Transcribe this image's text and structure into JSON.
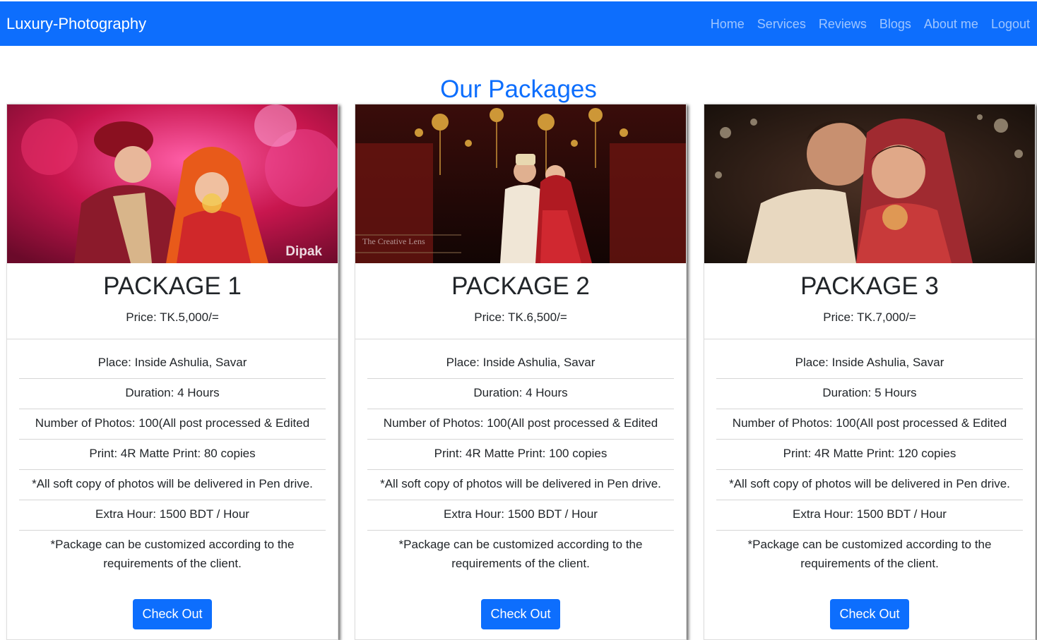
{
  "navbar": {
    "brand": "Luxury-Photography",
    "links": [
      "Home",
      "Services",
      "Reviews",
      "Blogs",
      "About me",
      "Logout"
    ],
    "bg_color": "#0d6efd"
  },
  "heading": "Our Packages",
  "packages": [
    {
      "title": "PACKAGE 1",
      "price": "Price: TK.5,000/=",
      "watermark": "Dipak",
      "features": [
        "Place: Inside Ashulia, Savar",
        "Duration: 4 Hours",
        "Number of Photos: 100(All post processed & Edited",
        "Print: 4R Matte Print: 80 copies",
        "*All soft copy of photos will be delivered in Pen drive.",
        "Extra Hour: 1500 BDT / Hour",
        "*Package can be customized according to the requirements of the client."
      ],
      "button": "Check Out"
    },
    {
      "title": "PACKAGE 2",
      "price": "Price: TK.6,500/=",
      "watermark": "The Creative Lens",
      "features": [
        "Place: Inside Ashulia, Savar",
        "Duration: 4 Hours",
        "Number of Photos: 100(All post processed & Edited",
        "Print: 4R Matte Print: 100 copies",
        "*All soft copy of photos will be delivered in Pen drive.",
        "Extra Hour: 1500 BDT / Hour",
        "*Package can be customized according to the requirements of the client."
      ],
      "button": "Check Out"
    },
    {
      "title": "PACKAGE 3",
      "price": "Price: TK.7,000/=",
      "watermark": "",
      "features": [
        "Place: Inside Ashulia, Savar",
        "Duration: 5 Hours",
        "Number of Photos: 100(All post processed & Edited",
        "Print: 4R Matte Print: 120 copies",
        "*All soft copy of photos will be delivered in Pen drive.",
        "Extra Hour: 1500 BDT / Hour",
        "*Package can be customized according to the requirements of the client."
      ],
      "button": "Check Out"
    }
  ]
}
